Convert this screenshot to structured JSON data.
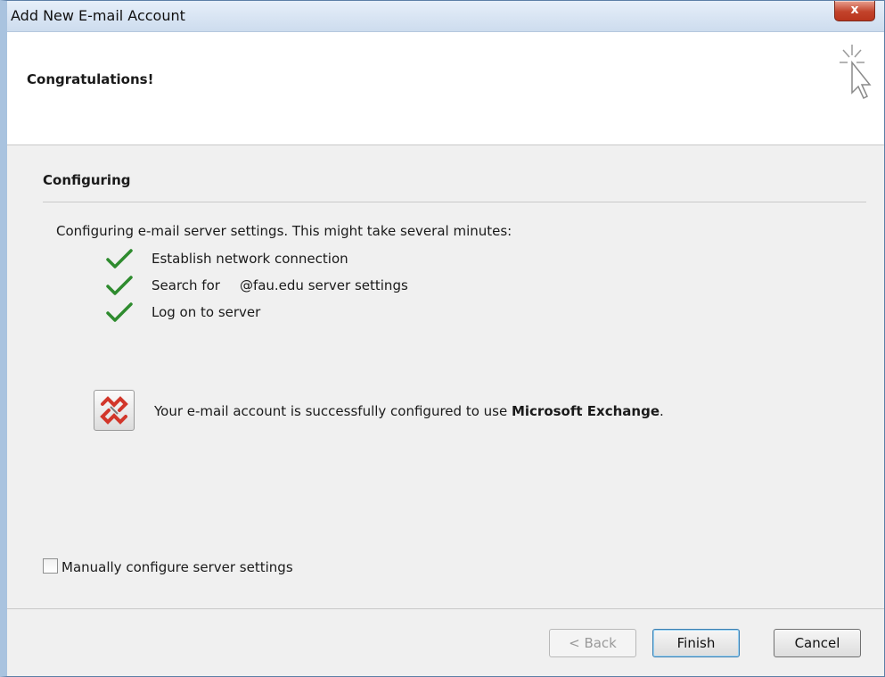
{
  "window": {
    "title": "Add New E-mail Account",
    "close_label": "x"
  },
  "header": {
    "title": "Congratulations!",
    "icon": "wizard-cursor-icon"
  },
  "section": {
    "title": "Configuring"
  },
  "description": "Configuring e-mail server settings. This might take several minutes:",
  "steps": [
    {
      "label": "Establish network connection",
      "status": "done"
    },
    {
      "label_prefix": "Search for",
      "label_suffix": "@fau.edu server settings",
      "status": "done"
    },
    {
      "label": "Log on to server",
      "status": "done"
    }
  ],
  "result": {
    "text": "Your e-mail account is successfully configured to use ",
    "product": "Microsoft Exchange",
    "suffix": ".",
    "icon": "exchange-icon"
  },
  "options": {
    "manual_config_label": "Manually configure server settings",
    "manual_config_checked": false
  },
  "buttons": {
    "back": "< Back",
    "finish": "Finish",
    "cancel": "Cancel"
  },
  "colors": {
    "check": "#2e8b2e",
    "exchange_red": "#d2362a"
  }
}
